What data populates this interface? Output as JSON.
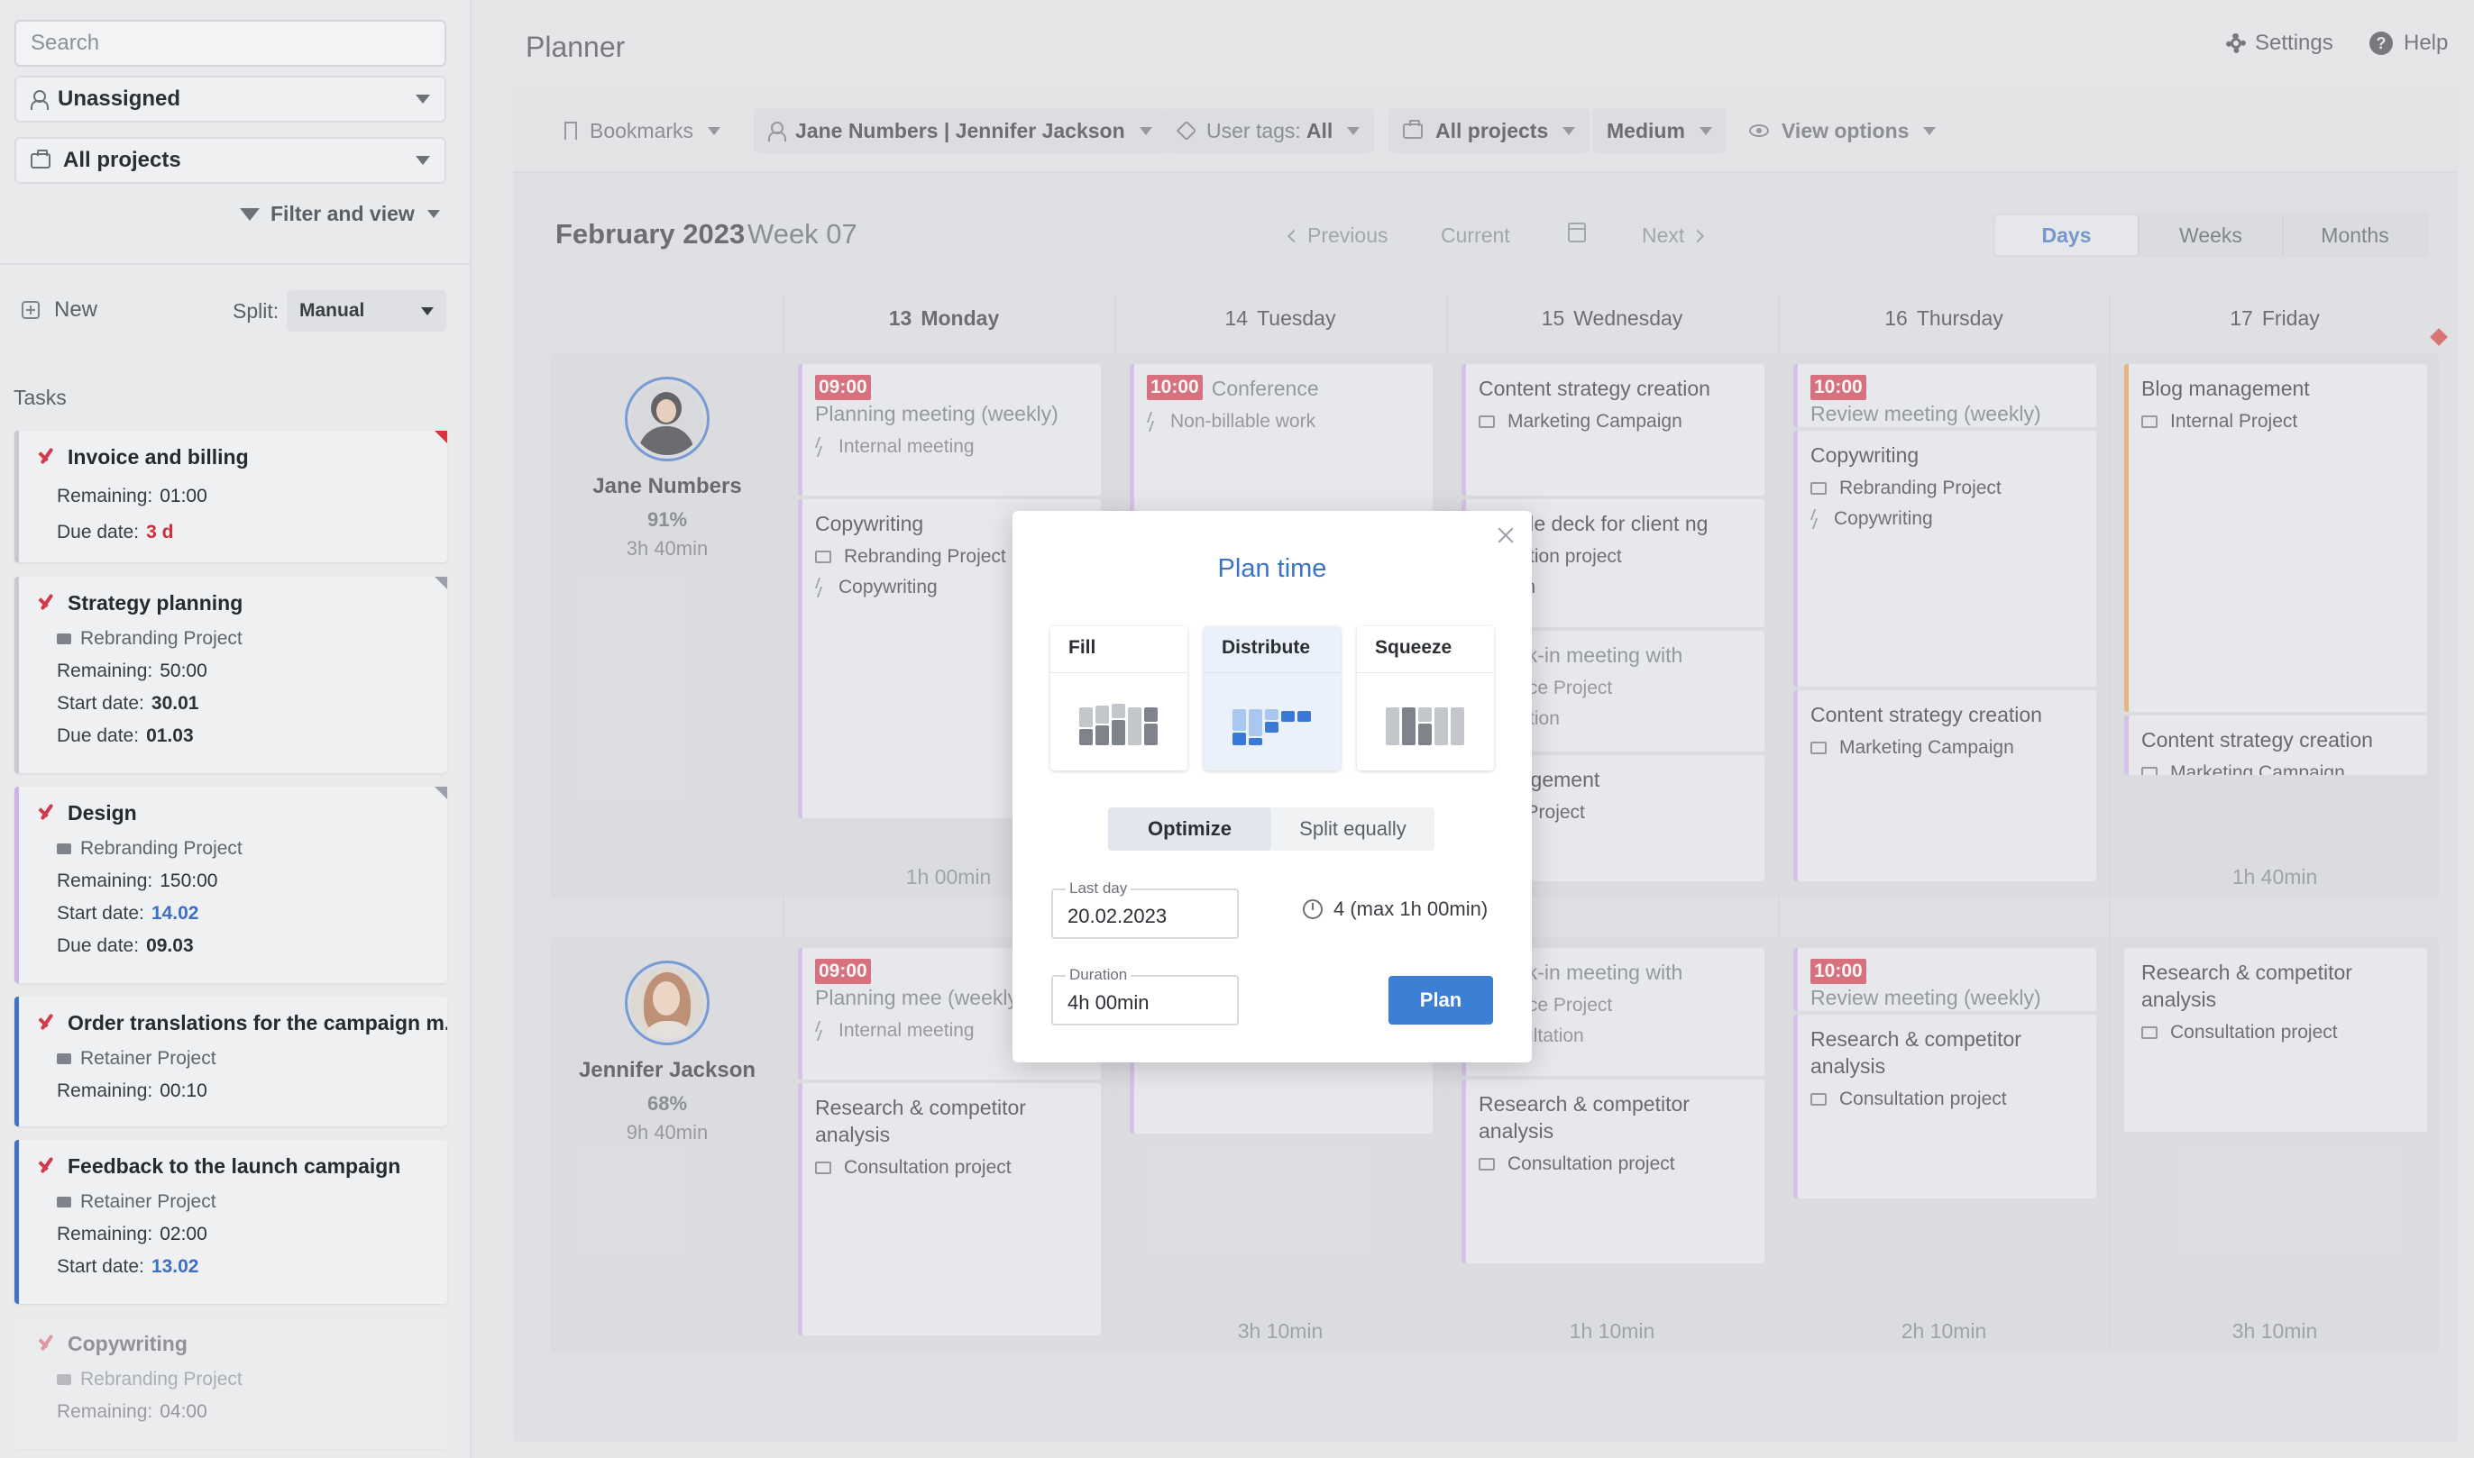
{
  "sidebar": {
    "search_placeholder": "Search",
    "assignee_filter": "Unassigned",
    "project_filter": "All projects",
    "filter_and_view": "Filter and view",
    "new_label": "New",
    "split_label": "Split:",
    "split_value": "Manual",
    "tasks_heading": "Tasks",
    "tasks": [
      {
        "title": "Invoice and billing",
        "remaining_label": "Remaining:",
        "remaining": "01:00",
        "due_label": "Due date:",
        "due": "3 d"
      },
      {
        "title": "Strategy planning",
        "project": "Rebranding Project",
        "remaining_label": "Remaining:",
        "remaining": "50:00",
        "start_label": "Start date:",
        "start": "30.01",
        "due_label": "Due date:",
        "due": "01.03"
      },
      {
        "title": "Design",
        "project": "Rebranding Project",
        "remaining_label": "Remaining:",
        "remaining": "150:00",
        "start_label": "Start date:",
        "start": "14.02",
        "due_label": "Due date:",
        "due": "09.03"
      },
      {
        "title": "Order translations for the campaign m...",
        "project": "Retainer Project",
        "remaining_label": "Remaining:",
        "remaining": "00:10"
      },
      {
        "title": "Feedback to the launch campaign",
        "project": "Retainer Project",
        "remaining_label": "Remaining:",
        "remaining": "02:00",
        "start_label": "Start date:",
        "start": "13.02"
      },
      {
        "title": "Copywriting",
        "project": "Rebranding Project",
        "remaining_label": "Remaining:",
        "remaining": "04:00"
      }
    ]
  },
  "header": {
    "title": "Planner",
    "settings": "Settings",
    "help": "Help"
  },
  "toolbar": {
    "bookmarks": "Bookmarks",
    "users": "Jane Numbers | Jennifer Jackson",
    "user_tags_label": "User tags:",
    "user_tags_value": "All",
    "projects": "All projects",
    "size": "Medium",
    "view_options": "View options"
  },
  "calendar": {
    "month": "February 2023",
    "week": "Week 07",
    "prev": "Previous",
    "current": "Current",
    "next": "Next",
    "views": [
      "Days",
      "Weeks",
      "Months"
    ],
    "active_view": "Days",
    "days": [
      {
        "num": "13",
        "name": "Monday"
      },
      {
        "num": "14",
        "name": "Tuesday"
      },
      {
        "num": "15",
        "name": "Wednesday"
      },
      {
        "num": "16",
        "name": "Thursday"
      },
      {
        "num": "17",
        "name": "Friday"
      }
    ]
  },
  "users": [
    {
      "name": "Jane Numbers",
      "utilization": "91%",
      "time": "3h 40min",
      "day_totals": [
        "1h 00min",
        "",
        "",
        "",
        "1h 40min"
      ],
      "events": {
        "mon": [
          {
            "time": "09:00",
            "title": "Planning meeting (weekly)",
            "sub": "Internal meeting"
          },
          {
            "title": "Copywriting",
            "project": "Rebranding Project",
            "sub": "Copywriting"
          }
        ],
        "tue": [
          {
            "time": "10:00",
            "title": "Conference",
            "sub": "Non-billable work"
          }
        ],
        "wed": [
          {
            "title": "Content strategy creation",
            "project": "Marketing Campaign"
          },
          {
            "title": "re slide deck for client ng",
            "project": "nsultation project",
            "sub": "search"
          },
          {
            "title": "Check-in meeting with",
            "project": "ed Price Project",
            "sub": "nsultation"
          },
          {
            "title": "management",
            "project": "ernal Project"
          }
        ],
        "thu": [
          {
            "time": "10:00",
            "title": "Review meeting (weekly)"
          },
          {
            "title": "Copywriting",
            "project": "Rebranding Project",
            "sub": "Copywriting"
          },
          {
            "title": "Content strategy creation",
            "project": "Marketing Campaign"
          }
        ],
        "fri": [
          {
            "title": "Blog management",
            "project": "Internal Project"
          },
          {
            "title": "Content strategy creation",
            "project": "Marketing Campaign"
          }
        ]
      }
    },
    {
      "name": "Jennifer Jackson",
      "utilization": "68%",
      "time": "9h 40min",
      "day_totals": [
        "",
        "3h 10min",
        "1h 10min",
        "2h 10min",
        "3h 10min"
      ],
      "events": {
        "mon": [
          {
            "time": "09:00",
            "title": "Planning mee (weekly)",
            "sub": "Internal meeting"
          },
          {
            "title": "Research & competitor analysis",
            "project": "Consultation project"
          }
        ],
        "wed": [
          {
            "title": "Check-in meeting with",
            "project": "ed Price Project",
            "sub": "Consultation"
          },
          {
            "title": "Research & competitor analysis",
            "project": "Consultation project"
          }
        ],
        "thu": [
          {
            "time": "10:00",
            "title": "Review meeting (weekly)"
          },
          {
            "title": "Research & competitor analysis",
            "project": "Consultation project"
          }
        ],
        "fri": [
          {
            "title": "Research & competitor analysis",
            "project": "Consultation project"
          }
        ]
      }
    }
  ],
  "modal": {
    "title": "Plan time",
    "modes": [
      "Fill",
      "Distribute",
      "Squeeze"
    ],
    "active_mode": "Distribute",
    "options": [
      "Optimize",
      "Split equally"
    ],
    "active_option": "Optimize",
    "last_day_label": "Last day",
    "last_day": "20.02.2023",
    "count": "4 (max 1h 00min)",
    "duration_label": "Duration",
    "duration": "4h 00min",
    "plan_button": "Plan"
  },
  "colors": {
    "accent": "#3d7fd4",
    "time_badge": "#cf3344",
    "check": "#d2394a"
  }
}
